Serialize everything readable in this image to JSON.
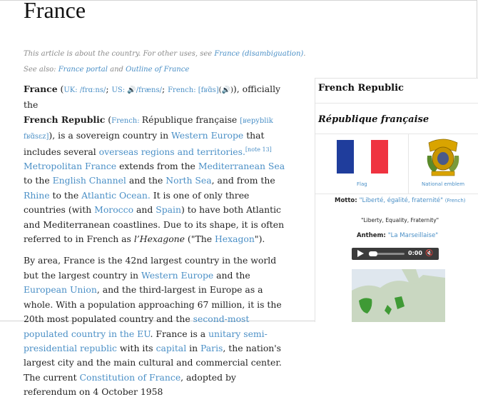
{
  "page": {
    "title": "France"
  },
  "hatnotes": {
    "line1_text": "This article is about the country. For other uses, see ",
    "line1_link": "France (disambiguation)",
    "line1_end": ".",
    "line2_text": "See also: ",
    "line2_link1": "France portal",
    "line2_and": " and ",
    "line2_link2": "Outline of France"
  },
  "article": {
    "p1": {
      "s1": "France",
      "s2": " (",
      "uk_label": "UK: ",
      "uk_ipa": "/frɑːns/",
      "s3": "; ",
      "us_label": "US: ",
      "us_speaker": "🔊",
      "us_ipa": "/fræns/",
      "s4": "; ",
      "fr_label": "French: ",
      "fr_ipa": "[fʁɑ̃s]",
      "fr_speaker": "(🔊)",
      "s5": "), officially the",
      "s6": "French Republic",
      "s7": " (",
      "fr2_label": "French: ",
      "s8": "République française ",
      "fr2_ipa": "[ʁepyblik fʁɑ̃sɛz]",
      "s9": "), is a sovereign country in ",
      "l_we": "Western Europe",
      "s10": " that includes several ",
      "l_ort": "overseas regions and territories.",
      "note": "[note 13]",
      "s11": " ",
      "l_mf": "Metropolitan France",
      "s12": " extends from the ",
      "l_ms": "Mediterranean Sea",
      "s13": " to the ",
      "l_ec": "English Channel",
      "s14": " and the ",
      "l_ns": "North Sea",
      "s15": ", and from the ",
      "l_rh": "Rhine",
      "s16": " to the ",
      "l_ao": "Atlantic Ocean.",
      "s17": " It is one of only three countries (with ",
      "l_mo": "Morocco",
      "s18": " and ",
      "l_sp": "Spain",
      "s19": ") to have both Atlantic and Mediterranean coastlines. Due to its shape, it is often referred to in French as ",
      "s20": "l’Hexagone",
      "s21": " (\"The ",
      "l_hex": "Hexagon",
      "s22": "\")."
    },
    "p2": {
      "s1": "By area, France is the 42nd largest country in the world but the largest country in ",
      "l_we": "Western Europe",
      "s2": " and the ",
      "l_eu": "European Union",
      "s3": ", and the third-largest in Europe as a whole. With a population approaching 67 million, it is the 20th most populated country and the ",
      "l_sec": "second-most populated country in the EU",
      "s4": ". France is a ",
      "l_usp": "unitary semi-presidential republic",
      "s5": " with its ",
      "l_cap": "capital",
      "s6": " in ",
      "l_par": "Paris",
      "s7": ", the nation's largest city and the main cultural and commercial center. The current ",
      "l_con": "Constitution of France",
      "s8": ", adopted by referendum on 4 October 1958"
    }
  },
  "infobox": {
    "title": "French Republic",
    "native_name": "République française",
    "flag_caption": "Flag",
    "emblem_caption": "National emblem",
    "motto_label": "Motto: ",
    "motto_value": "\"Liberté, égalité, fraternité\"",
    "motto_lang": "(French)",
    "motto_translation": "\"Liberty, Equality, Fraternity\"",
    "anthem_label": "Anthem: ",
    "anthem_value": "\"La Marseillaise\"",
    "audio_time": "0:00"
  },
  "colors": {
    "link": "#4a8fc6",
    "flag_blue": "#1f3d9c",
    "flag_white": "#ffffff",
    "flag_red": "#ef3340",
    "emblem_gold": "#d9a400",
    "map_land": "#c9d7c1",
    "map_highlight": "#3f9a35"
  }
}
